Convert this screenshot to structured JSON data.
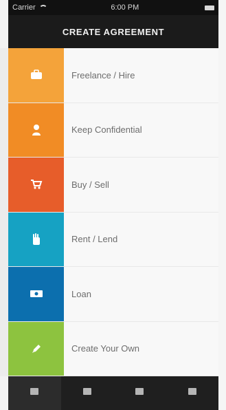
{
  "status_bar": {
    "carrier": "Carrier",
    "time": "6:00 PM"
  },
  "nav": {
    "title": "CREATE AGREEMENT"
  },
  "colors": {
    "freelance": "#f4a33a",
    "confidential": "#f18c25",
    "buy_sell": "#e75d2a",
    "rent_lend": "#16a2c3",
    "loan": "#0c6fae",
    "create": "#8dc33f"
  },
  "menu": {
    "items": [
      {
        "label": "Freelance / Hire",
        "icon": "briefcase-icon",
        "color": "#f4a33a"
      },
      {
        "label": "Keep Confidential",
        "icon": "person-icon",
        "color": "#f18c25"
      },
      {
        "label": "Buy / Sell",
        "icon": "cart-icon",
        "color": "#e75d2a"
      },
      {
        "label": "Rent / Lend",
        "icon": "hand-icon",
        "color": "#16a2c3"
      },
      {
        "label": "Loan",
        "icon": "cash-icon",
        "color": "#0c6fae"
      },
      {
        "label": "Create Your Own",
        "icon": "pencil-icon",
        "color": "#8dc33f"
      }
    ]
  },
  "tabs": [
    {
      "label": "",
      "icon": "create-tab-icon"
    },
    {
      "label": "",
      "icon": "agreements-tab-icon"
    },
    {
      "label": "",
      "icon": "contacts-tab-icon"
    },
    {
      "label": "",
      "icon": "settings-tab-icon"
    }
  ]
}
